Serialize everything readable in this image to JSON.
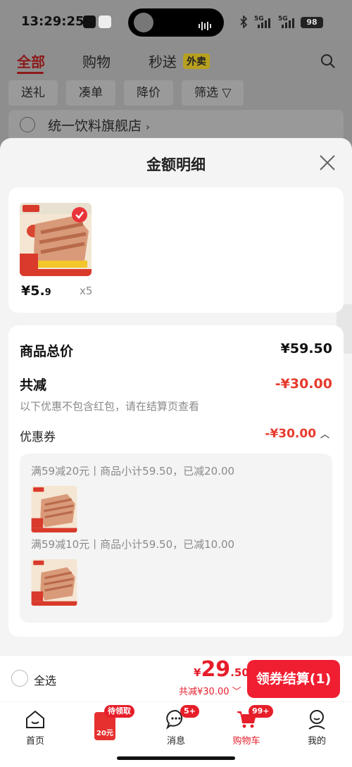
{
  "status_bar": {
    "time": "13:29:25",
    "network_1": "5G",
    "network_2": "5G",
    "battery": "98"
  },
  "background_page": {
    "tabs": [
      "全部",
      "购物",
      "秒送"
    ],
    "waimai_badge": "外卖",
    "filters": [
      "送礼",
      "凑单",
      "降价",
      "筛选"
    ],
    "store_name": "统一饮料旗舰店",
    "colors": {
      "active_tab": "#e61e2a"
    }
  },
  "sheet": {
    "title": "金额明细",
    "product": {
      "price_int": "¥5.",
      "price_dec": "9",
      "qty": "x5"
    },
    "total_label": "商品总价",
    "total_value": "¥59.50",
    "reduce_label": "共减",
    "reduce_value": "-¥30.00",
    "reduce_note": "以下优惠不包含红包，请在结算页查看",
    "coupon_label": "优惠券",
    "coupon_value": "-¥30.00",
    "coupons": [
      {
        "text": "满59减20元丨商品小计59.50，已减20.00"
      },
      {
        "text": "满59减10元丨商品小计59.50，已减10.00"
      }
    ]
  },
  "checkout": {
    "select_all": "全选",
    "price_yen": "¥",
    "price_int": "29",
    "price_dec": ".50",
    "discount_text": "共减¥30.00",
    "button_label": "领券结算(1)"
  },
  "nav": {
    "items": [
      {
        "label": "首页",
        "icon": "home-icon"
      },
      {
        "label": "",
        "icon": "red-packet-icon",
        "badge": "待领取",
        "hongbao_text": "20元"
      },
      {
        "label": "消息",
        "icon": "message-icon",
        "badge": "5+"
      },
      {
        "label": "购物车",
        "icon": "cart-icon",
        "badge": "99+",
        "active": true
      },
      {
        "label": "我的",
        "icon": "profile-icon"
      }
    ]
  }
}
